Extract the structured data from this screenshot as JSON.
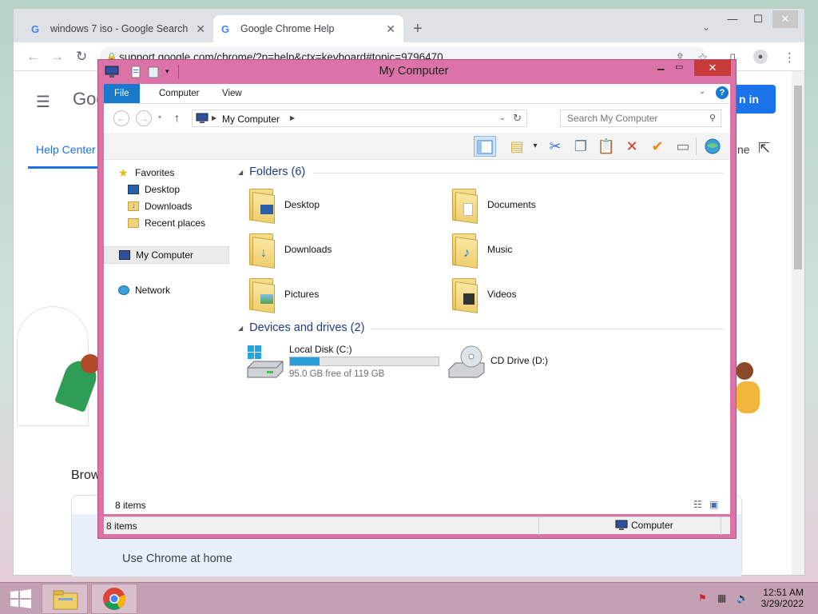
{
  "browser": {
    "tabs": [
      {
        "label": "windows 7 iso - Google Search",
        "favicon": "G"
      },
      {
        "label": "Google Chrome Help",
        "favicon": "G"
      }
    ],
    "new_tab": "+",
    "url": "support.google.com/chrome/?p=help&ctx=keyboard#topic=9796470",
    "page": {
      "logo_partial": "Goo",
      "nav_tab": "Help Center",
      "signin_partial": "n in",
      "partial_right": "ne",
      "partial_browse": "Brow",
      "card_text": "Use Chrome at home"
    },
    "colors": {
      "accent": "#1a73e8"
    }
  },
  "explorer": {
    "title": "My Computer",
    "ribbon_tabs": [
      "File",
      "Computer",
      "View"
    ],
    "help": "?",
    "address": "My Computer",
    "search_placeholder": "Search My Computer",
    "nav": {
      "favorites": "Favorites",
      "desktop": "Desktop",
      "downloads": "Downloads",
      "recent": "Recent places",
      "my_computer": "My Computer",
      "network": "Network"
    },
    "folders_header": "Folders (6)",
    "folders": [
      "Desktop",
      "Documents",
      "Downloads",
      "Music",
      "Pictures",
      "Videos"
    ],
    "drives_header": "Devices and drives (2)",
    "drives": [
      {
        "name": "Local Disk (C:)",
        "free": "95.0 GB free of 119 GB",
        "used_fraction": 0.2
      },
      {
        "name": "CD Drive (D:)"
      }
    ],
    "item_count": "8 items",
    "status_count": "8 items",
    "status_location": "Computer",
    "colors": {
      "frame": "#db73a8",
      "selected_tab": "#1979ca",
      "header_text": "#1e3b8c"
    }
  },
  "taskbar": {
    "time": "12:51 AM",
    "date": "3/29/2022"
  }
}
